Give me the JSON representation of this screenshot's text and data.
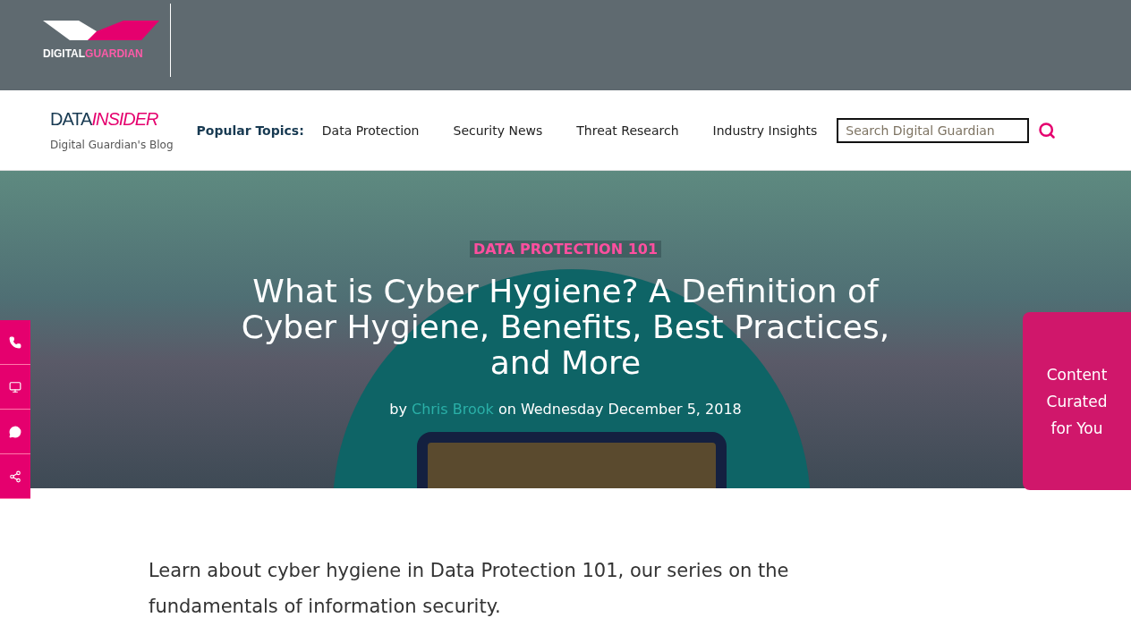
{
  "brand": {
    "word_1": "DIGITAL",
    "word_2": "GUARDIAN"
  },
  "blog": {
    "logo_1": "DATA",
    "logo_2": "INSIDER",
    "tagline": "Digital Guardian's Blog"
  },
  "nav": {
    "label": "Popular Topics:",
    "links": [
      "Data Protection",
      "Security News",
      "Threat Research",
      "Industry Insights"
    ]
  },
  "search": {
    "placeholder": "Search Digital Guardian"
  },
  "hero": {
    "category": "DATA PROTECTION 101",
    "title": "What is Cyber Hygiene? A Definition of Cyber Hygiene, Benefits, Best Practices, and More",
    "byline": {
      "prefix": "by",
      "author": "Chris Brook",
      "suffix": "on Wednesday December 5, 2018"
    }
  },
  "side_buttons": [
    {
      "kind": "phone"
    },
    {
      "kind": "monitor"
    },
    {
      "kind": "chat"
    },
    {
      "kind": "share"
    }
  ],
  "curated": "Content Curated for You",
  "intro": "Learn about cyber hygiene in Data Protection 101, our series on the fundamentals of information security."
}
